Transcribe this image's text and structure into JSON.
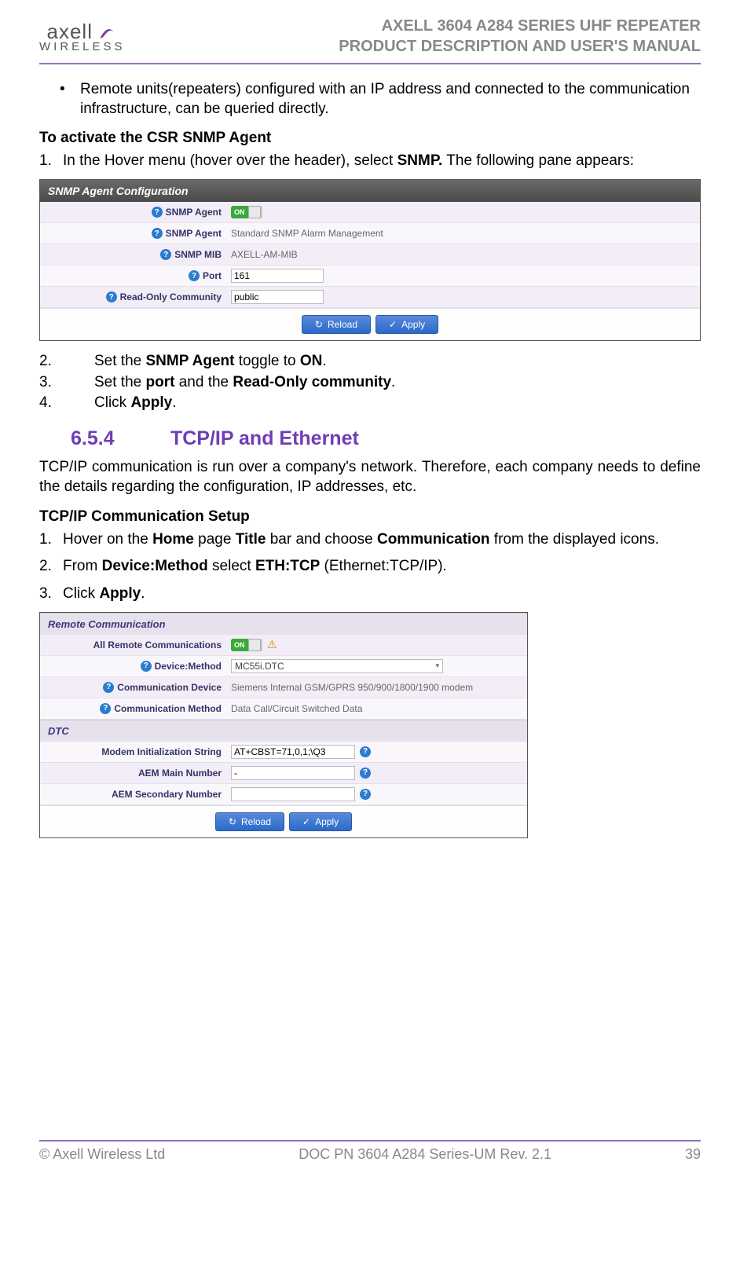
{
  "header": {
    "logo_text": "axell",
    "logo_sub": "WIRELESS",
    "title_line1": "AXELL 3604 A284 SERIES UHF REPEATER",
    "title_line2": "PRODUCT DESCRIPTION AND USER'S MANUAL"
  },
  "bullet1": "Remote units(repeaters)  configured with an IP address and connected to the communication infrastructure, can be queried directly.",
  "snmp": {
    "activate_heading": "To activate the CSR SNMP Agent",
    "step1_pre": "In the Hover menu (hover over the header), select ",
    "step1_bold": "SNMP.",
    "step1_post": " The following pane appears:",
    "panel_title": "SNMP Agent Configuration",
    "rows": {
      "agent_toggle_label": "SNMP Agent",
      "agent_toggle_value": "ON",
      "agent_label": "SNMP Agent",
      "agent_value": "Standard SNMP Alarm Management",
      "mib_label": "SNMP MIB",
      "mib_value": "AXELL-AM-MIB",
      "port_label": "Port",
      "port_value": "161",
      "community_label": "Read-Only Community",
      "community_value": "public"
    },
    "reload": "Reload",
    "apply": "Apply",
    "step2_pre": "Set the ",
    "step2_b1": "SNMP Agent",
    "step2_mid": " toggle to ",
    "step2_b2": "ON",
    "step3_pre": "Set the ",
    "step3_b1": "port",
    "step3_mid": " and the ",
    "step3_b2": "Read-Only community",
    "step4_pre": "Click ",
    "step4_b1": "Apply"
  },
  "section": {
    "number": "6.5.4",
    "title": "TCP/IP and Ethernet",
    "para": "TCP/IP communication is run over a company's network. Therefore, each company needs to define the details regarding the configuration, IP addresses, etc."
  },
  "tcpip": {
    "heading": "TCP/IP Communication Setup",
    "s1_pre": "Hover on the ",
    "s1_b1": "Home",
    "s1_mid1": " page ",
    "s1_b2": "Title",
    "s1_mid2": " bar and choose ",
    "s1_b3": "Communication",
    "s1_post": " from the displayed icons.",
    "s2_pre": "From ",
    "s2_b1": "Device:Method",
    "s2_mid": " select ",
    "s2_b2": "ETH:TCP",
    "s2_post": " (Ethernet:TCP/IP).",
    "s3_pre": "Click ",
    "s3_b1": "Apply"
  },
  "remote": {
    "panel_title": "Remote Communication",
    "rows": {
      "all_label": "All Remote Communications",
      "all_value": "ON",
      "method_label": "Device:Method",
      "method_value": "MC55i.DTC",
      "device_label": "Communication Device",
      "device_value": "Siemens Internal GSM/GPRS 950/900/1800/1900 modem",
      "cmethod_label": "Communication Method",
      "cmethod_value": "Data Call/Circuit Switched Data"
    },
    "dtc_title": "DTC",
    "dtc": {
      "init_label": "Modem Initialization String",
      "init_value": "AT+CBST=71,0,1;\\Q3",
      "main_label": "AEM Main Number",
      "main_value": "-",
      "sec_label": "AEM Secondary Number",
      "sec_value": ""
    },
    "reload": "Reload",
    "apply": "Apply"
  },
  "footer": {
    "left": "© Axell Wireless Ltd",
    "center": "DOC PN 3604 A284 Series-UM Rev. 2.1",
    "right": "39"
  },
  "nums": {
    "n1": "1.",
    "n2": "2.",
    "n3": "3.",
    "n4": "4."
  },
  "glyphs": {
    "bullet": "•",
    "help": "?",
    "warn": "⚠",
    "reload": "↻",
    "check": "✓",
    "caret": "▾",
    "dot": "."
  }
}
